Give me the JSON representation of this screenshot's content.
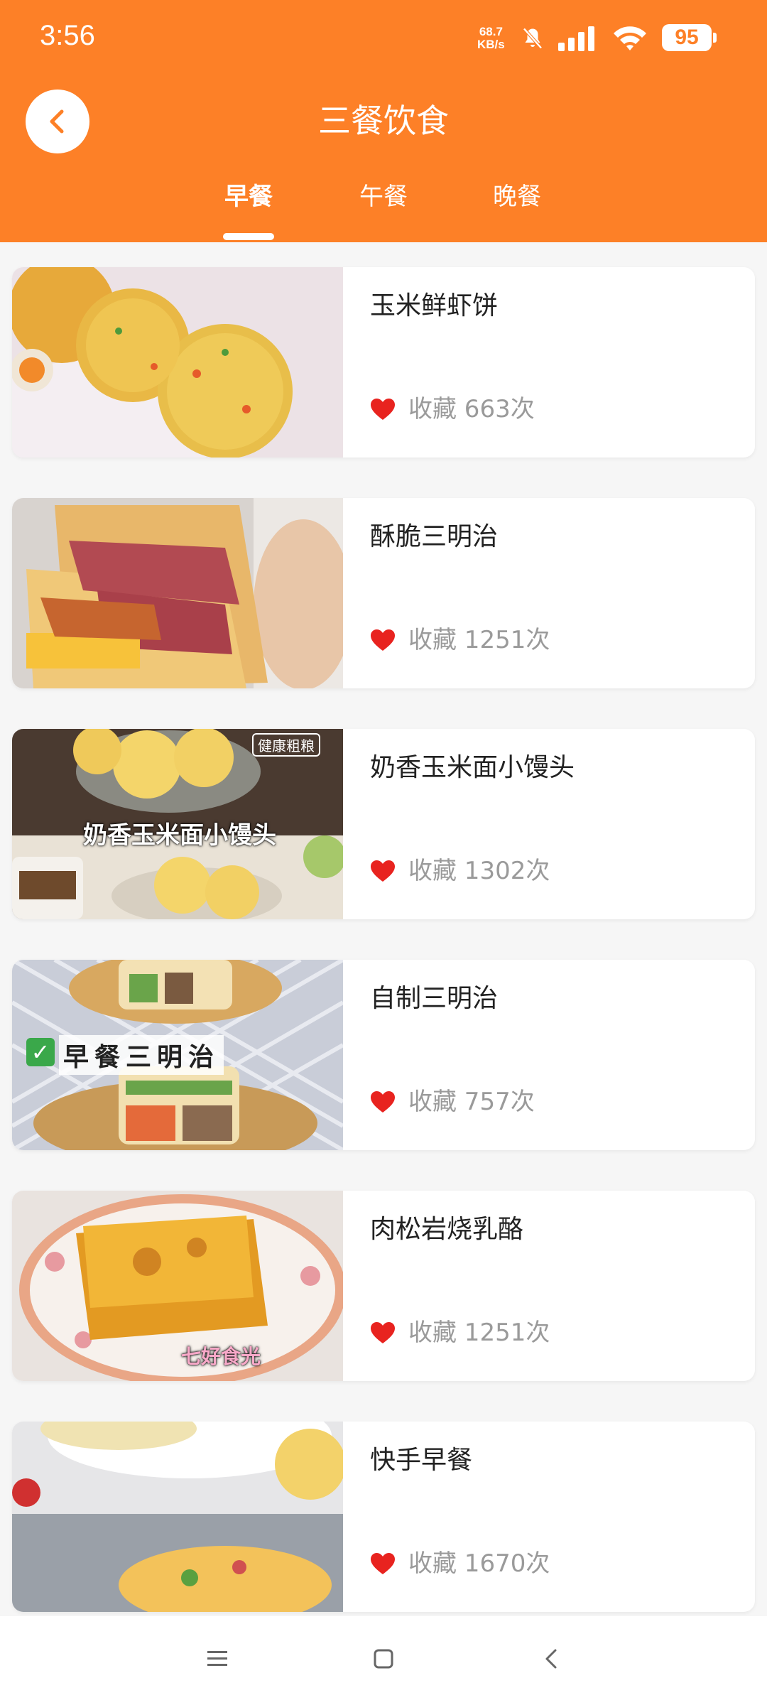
{
  "status_bar": {
    "time": "3:56",
    "net_speed_value": "68.7",
    "net_speed_unit": "KB/s",
    "battery": "95",
    "icons": [
      "bell-muted-icon",
      "signal-icon",
      "wifi-icon",
      "battery-icon"
    ]
  },
  "header": {
    "title": "三餐饮食",
    "back_icon": "chevron-left-icon",
    "background": "#fd8027"
  },
  "tabs": [
    {
      "label": "早餐",
      "active": true
    },
    {
      "label": "午餐",
      "active": false
    },
    {
      "label": "晚餐",
      "active": false
    }
  ],
  "recipes": [
    {
      "name": "玉米鲜虾饼",
      "favorites": "收藏 663次",
      "image_overlay": ""
    },
    {
      "name": "酥脆三明治",
      "favorites": "收藏 1251次",
      "image_overlay": ""
    },
    {
      "name": "奶香玉米面小馒头",
      "favorites": "收藏 1302次",
      "image_overlay": "奶香玉米面小馒头",
      "image_tag": "健康粗粮"
    },
    {
      "name": "自制三明治",
      "favorites": "收藏 757次",
      "image_overlay": "早餐三明治"
    },
    {
      "name": "肉松岩烧乳酪",
      "favorites": "收藏 1251次",
      "image_overlay": "七好食光"
    },
    {
      "name": "快手早餐",
      "favorites": "收藏 1670次",
      "image_overlay": ""
    }
  ],
  "nav_bar": {
    "icons": [
      "menu-icon",
      "home-square-icon",
      "back-triangle-icon"
    ]
  },
  "colors": {
    "accent": "#fd8027",
    "heart": "#e8231f",
    "fav_text": "#9a9a9a"
  }
}
